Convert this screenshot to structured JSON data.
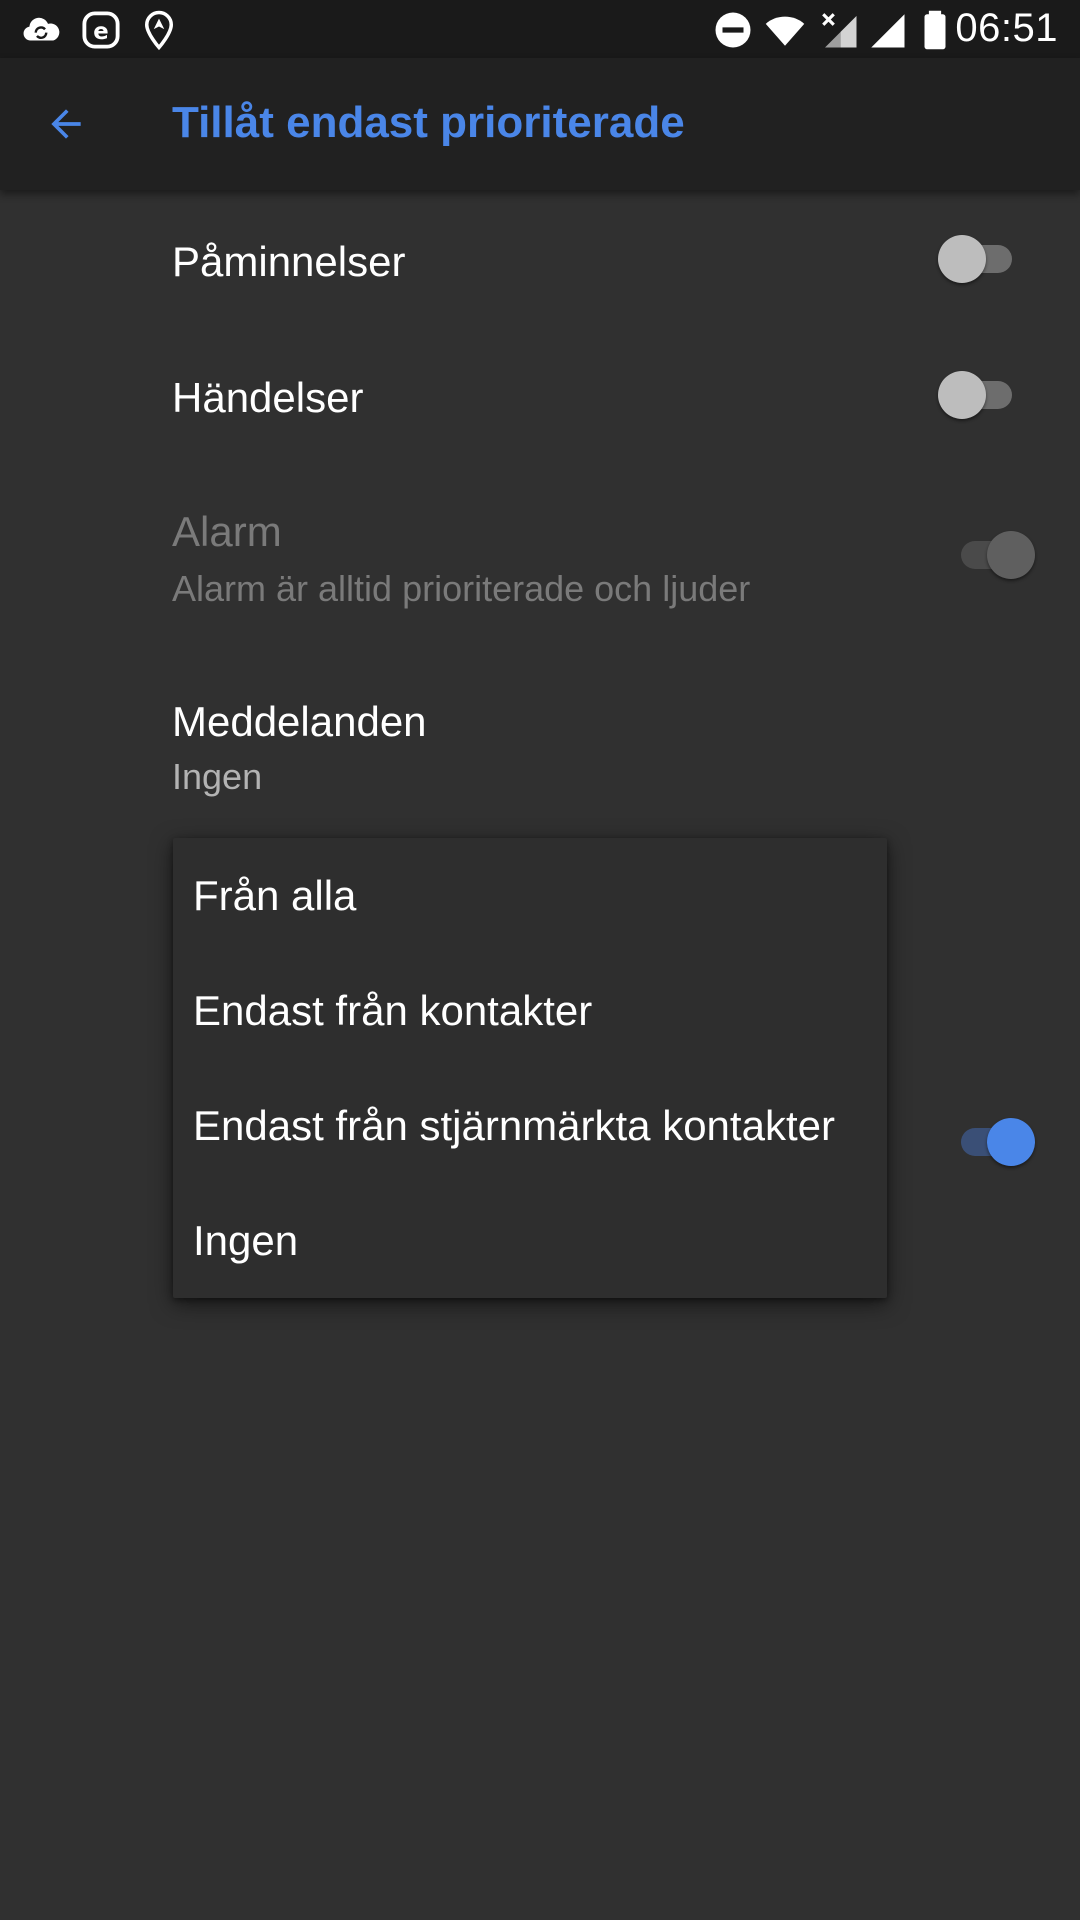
{
  "status_bar": {
    "time": "06:51",
    "icons": [
      "cloud-sync-icon",
      "e-app-icon",
      "location-icon",
      "do-not-disturb-icon",
      "wifi-icon",
      "signal-no-data-icon",
      "signal-icon",
      "battery-icon"
    ]
  },
  "toolbar": {
    "back_icon": "arrow-back-icon",
    "title": "Tillåt endast prioriterade",
    "accent_color": "#4a86e8"
  },
  "settings": {
    "reminders": {
      "title": "Påminnelser",
      "checked": false
    },
    "events": {
      "title": "Händelser",
      "checked": false
    },
    "alarm": {
      "title": "Alarm",
      "summary": "Alarm är alltid prioriterade och ljuder",
      "checked": true,
      "enabled": false
    },
    "messages": {
      "title": "Meddelanden",
      "summary": "Ingen"
    },
    "hidden_row": {
      "checked": true
    }
  },
  "menu": {
    "items": [
      "Från alla",
      "Endast från kontakter",
      "Endast från stjärnmärkta kontakter",
      "Ingen"
    ]
  }
}
